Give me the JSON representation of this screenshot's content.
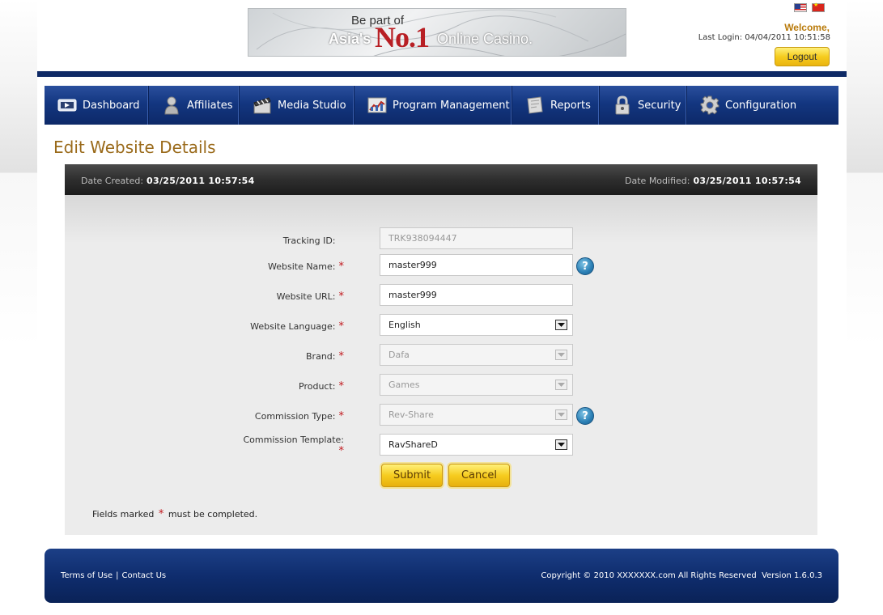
{
  "header": {
    "banner": {
      "line1": "Be part of",
      "line2a": "Asia's",
      "line2b": "No.1",
      "line2c": "Online Casino."
    },
    "welcome": "Welcome,",
    "last_login_label": "Last Login:",
    "last_login_value": "04/04/2011 10:51:58",
    "logout_label": "Logout",
    "flags": [
      "us-flag-icon",
      "cn-flag-icon"
    ]
  },
  "nav": {
    "items": [
      {
        "label": "Dashboard",
        "icon": "dashboard-icon"
      },
      {
        "label": "Affiliates",
        "icon": "person-icon"
      },
      {
        "label": "Media Studio",
        "icon": "clapperboard-icon"
      },
      {
        "label": "Program Management",
        "icon": "chart-icon"
      },
      {
        "label": "Reports",
        "icon": "report-icon"
      },
      {
        "label": "Security",
        "icon": "lock-icon"
      },
      {
        "label": "Configuration",
        "icon": "gear-icon"
      }
    ]
  },
  "page": {
    "title": "Edit Website Details"
  },
  "meta": {
    "created_label": "Date Created:",
    "created_value": "03/25/2011 10:57:54",
    "modified_label": "Date Modified:",
    "modified_value": "03/25/2011 10:57:54"
  },
  "form": {
    "tracking_id": {
      "label": "Tracking ID:",
      "value": "TRK938094447"
    },
    "website_name": {
      "label": "Website Name:",
      "value": "master999"
    },
    "website_url": {
      "label": "Website URL:",
      "value": "master999"
    },
    "website_language": {
      "label": "Website Language:",
      "value": "English"
    },
    "brand": {
      "label": "Brand:",
      "value": "Dafa"
    },
    "product": {
      "label": "Product:",
      "value": "Games"
    },
    "commission_type": {
      "label": "Commission Type:",
      "value": "Rev-Share"
    },
    "commission_template": {
      "label": "Commission Template:",
      "value": "RavShareD"
    },
    "required_marker": "*",
    "help_glyph": "?",
    "submit_label": "Submit",
    "cancel_label": "Cancel",
    "note_before": "Fields marked",
    "note_after": "must be completed."
  },
  "footer": {
    "terms": "Terms of Use",
    "separator": "|",
    "contact": "Contact Us",
    "copyright": "Copyright © 2010 XXXXXXX.com All Rights Reserved",
    "version": "Version 1.6.0.3"
  },
  "colors": {
    "nav_blue": "#133680",
    "accent_gold": "#f6cc1f",
    "title_brown": "#9a6a1a",
    "required_red": "#c0151b"
  }
}
